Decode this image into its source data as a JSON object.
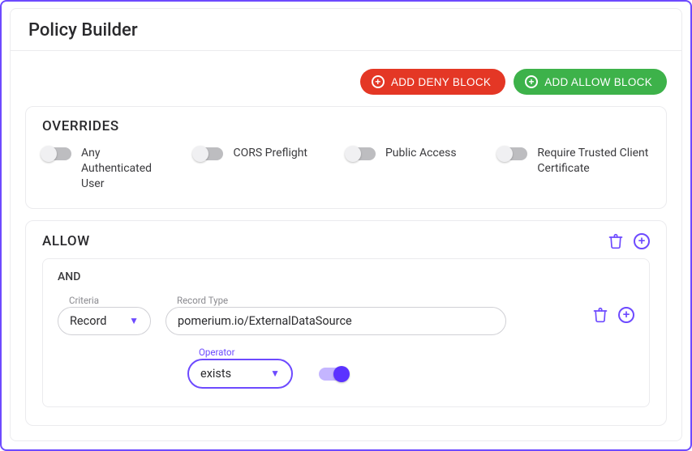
{
  "title": "Policy Builder",
  "buttons": {
    "add_deny": "ADD DENY BLOCK",
    "add_allow": "ADD ALLOW BLOCK"
  },
  "overrides": {
    "heading": "OVERRIDES",
    "items": [
      {
        "label": "Any Authenticated User",
        "on": false
      },
      {
        "label": "CORS Preflight",
        "on": false
      },
      {
        "label": "Public Access",
        "on": false
      },
      {
        "label": "Require Trusted Client Certificate",
        "on": false
      }
    ]
  },
  "allow": {
    "heading": "ALLOW",
    "rule_operator": "AND",
    "criteria": {
      "label": "Criteria",
      "value": "Record"
    },
    "record_type": {
      "label": "Record Type",
      "value": "pomerium.io/ExternalDataSource"
    },
    "operator": {
      "label": "Operator",
      "value": "exists"
    },
    "operator_toggle_on": true
  }
}
